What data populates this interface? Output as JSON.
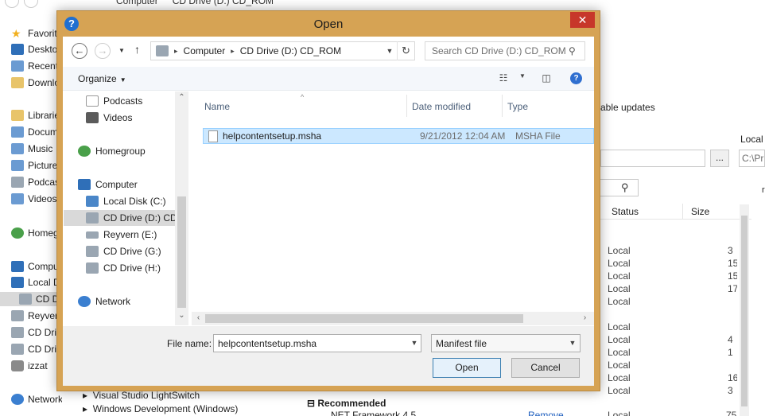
{
  "background_window": {
    "breadcrumb": [
      "Computer",
      "CD Drive (D:) CD_ROM"
    ],
    "nav_items": [
      {
        "label": "Favorites",
        "icon": "star-icon"
      },
      {
        "label": "Desktop",
        "icon": "desktop-icon"
      },
      {
        "label": "Recent places",
        "icon": "recent-icon"
      },
      {
        "label": "Downloads",
        "icon": "downloads-icon"
      },
      {
        "label": "Libraries",
        "icon": "library-icon"
      },
      {
        "label": "Documents",
        "icon": "documents-icon"
      },
      {
        "label": "Music",
        "icon": "music-icon"
      },
      {
        "label": "Pictures",
        "icon": "pictures-icon"
      },
      {
        "label": "Podcasts",
        "icon": "podcasts-icon"
      },
      {
        "label": "Videos",
        "icon": "videos-icon"
      },
      {
        "label": "Homegroup",
        "icon": "homegroup-icon"
      },
      {
        "label": "Computer",
        "icon": "computer-icon"
      },
      {
        "label": "Local Disk (C:)",
        "icon": "local-disk-icon"
      },
      {
        "label": "CD Drive (D:) CD_ROM",
        "icon": "cd-drive-icon"
      },
      {
        "label": "Reyvern (E:)",
        "icon": "drive-icon"
      },
      {
        "label": "CD Drive (G:)",
        "icon": "cd-drive-icon"
      },
      {
        "label": "CD Drive (H:)",
        "icon": "cd-drive-icon"
      },
      {
        "label": "izzat",
        "icon": "user-icon"
      },
      {
        "label": "Network",
        "icon": "network-icon"
      }
    ],
    "updates_text": "able updates",
    "local_label": "Local",
    "path_value": "C:\\Pr",
    "browse_label": "...",
    "table_headers": {
      "status": "Status",
      "size": "Size"
    },
    "rows": [
      {
        "status": "Local",
        "size": "3"
      },
      {
        "status": "Local",
        "size": "15"
      },
      {
        "status": "Local",
        "size": "15"
      },
      {
        "status": "Local",
        "size": "17"
      },
      {
        "status": "Local",
        "size": ""
      },
      {
        "status": "",
        "size": ""
      },
      {
        "status": "Local",
        "size": ""
      },
      {
        "status": "Local",
        "size": "4"
      },
      {
        "status": "Local",
        "size": "1"
      },
      {
        "status": "Local",
        "size": ""
      },
      {
        "status": "Local",
        "size": "16"
      },
      {
        "status": "Local",
        "size": "3"
      }
    ],
    "bottom_items": {
      "item1": "Visual Studio LightSwitch",
      "item2": "Windows Development (Windows)",
      "recommended": "Recommended",
      "framework": "NET Framework 4.5",
      "remove": "Remove",
      "last_status": "Local",
      "last_size": "75"
    }
  },
  "dialog": {
    "title": "Open",
    "close_glyph": "✕",
    "address_crumbs": [
      "Computer",
      "CD Drive (D:) CD_ROM"
    ],
    "search_placeholder": "Search CD Drive (D:) CD_ROM",
    "organize_label": "Organize",
    "nav_items": [
      {
        "label": "Podcasts",
        "icon": "podcasts-icon"
      },
      {
        "label": "Videos",
        "icon": "videos-icon"
      },
      {
        "label": "Homegroup",
        "icon": "homegroup-icon"
      },
      {
        "label": "Computer",
        "icon": "computer-icon"
      },
      {
        "label": "Local Disk (C:)",
        "icon": "local-disk-icon"
      },
      {
        "label": "CD Drive (D:) CD_ROM",
        "icon": "cd-drive-icon"
      },
      {
        "label": "Reyvern (E:)",
        "icon": "drive-icon"
      },
      {
        "label": "CD Drive (G:)",
        "icon": "cd-drive-icon"
      },
      {
        "label": "CD Drive (H:)",
        "icon": "cd-drive-icon"
      },
      {
        "label": "Network",
        "icon": "network-icon"
      }
    ],
    "columns": {
      "name": "Name",
      "date": "Date modified",
      "type": "Type"
    },
    "files": [
      {
        "name": "helpcontentsetup.msha",
        "date": "9/21/2012 12:04 AM",
        "type": "MSHA File"
      }
    ],
    "file_name_label": "File name:",
    "file_name_value": "helpcontentsetup.msha",
    "filter_value": "Manifest file",
    "open_label": "Open",
    "cancel_label": "Cancel",
    "colors": {
      "frame": "#d6a354",
      "close": "#c7372a",
      "selection": "#cce8ff",
      "accent": "#1f6fd0"
    }
  }
}
